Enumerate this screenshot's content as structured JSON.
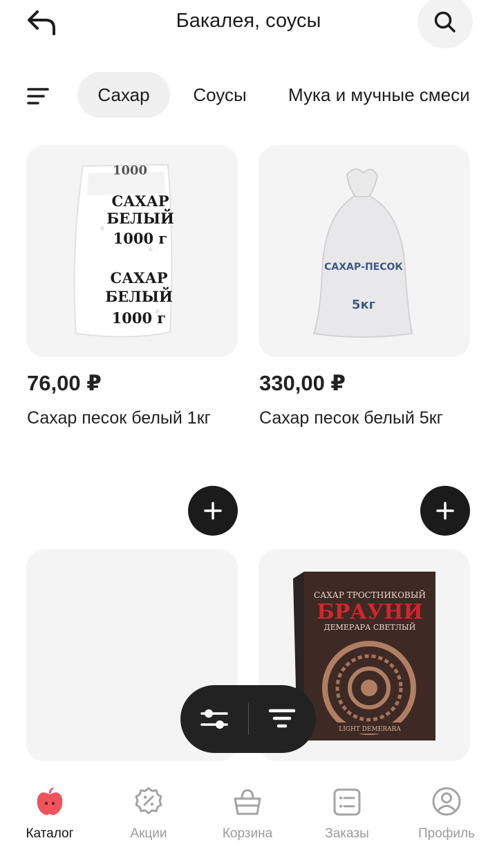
{
  "header": {
    "title": "Бакалея, соусы",
    "back_icon": "back-arrow-icon",
    "search_icon": "search-icon"
  },
  "categories": {
    "menu_icon": "menu-sort-icon",
    "items": [
      {
        "label": "Сахар",
        "active": true
      },
      {
        "label": "Соусы",
        "active": false
      },
      {
        "label": "Мука и мучные смеси",
        "active": false
      }
    ]
  },
  "products": [
    {
      "price": "76,00 ₽",
      "name": "Сахар песок белый 1кг",
      "package_lines": [
        "1000",
        "САХАР",
        "БЕЛЫЙ",
        "1000 г",
        "САХАР",
        "БЕЛЫЙ",
        "1000 г"
      ]
    },
    {
      "price": "330,00 ₽",
      "name": "Сахар песок белый 5кг",
      "package_lines": [
        "САХАР-ПЕСОК",
        "5кг"
      ]
    },
    {
      "price": "",
      "name": ""
    },
    {
      "price": "",
      "name": "",
      "package_lines": [
        "САХАР ТРОСТНИКОВЫЙ",
        "БРАУНИ",
        "ДЕМЕРАРА СВЕТЛЫЙ",
        "LIGHT DEMERARA"
      ]
    }
  ],
  "floating_bar": {
    "filter_icon": "sliders-icon",
    "sort_icon": "sort-funnel-icon"
  },
  "bottom_nav": [
    {
      "label": "Каталог",
      "icon": "apple-catalog-icon",
      "active": true
    },
    {
      "label": "Акции",
      "icon": "discount-badge-icon",
      "active": false
    },
    {
      "label": "Корзина",
      "icon": "basket-icon",
      "active": false
    },
    {
      "label": "Заказы",
      "icon": "orders-list-icon",
      "active": false
    },
    {
      "label": "Профиль",
      "icon": "profile-icon",
      "active": false
    }
  ],
  "colors": {
    "accent": "#f0535b",
    "dark": "#1b1b1b",
    "chip_bg": "#f0f0f0",
    "card_bg": "#f4f4f4"
  }
}
